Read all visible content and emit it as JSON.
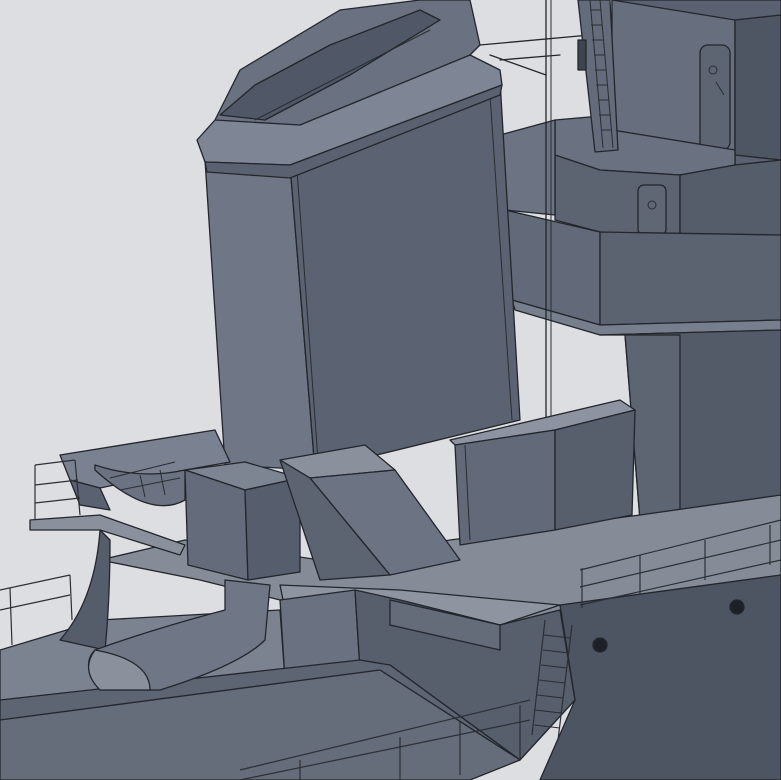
{
  "scene": {
    "subject": "ship-superstructure-cad-render",
    "colors": {
      "background": "#dcdee2",
      "hull_dark": "#4f5664",
      "hull_mid": "#5f6675",
      "hull_light": "#737a89",
      "deck": "#8a909c",
      "edge": "#23262c"
    }
  }
}
